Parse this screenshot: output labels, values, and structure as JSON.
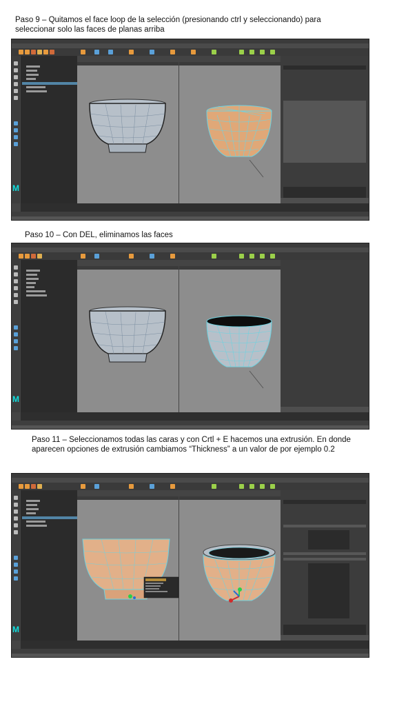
{
  "steps": [
    {
      "caption": "Paso 9 – Quitamos el face loop de la selección (presionando ctrl y seleccionando) para seleccionar solo las faces de planas arriba"
    },
    {
      "caption": "Paso 10 – Con DEL, eliminamos las faces"
    },
    {
      "caption": "Paso 11 – Seleccionamos todas las caras y con Crtl + E hacemos una extrusión. En donde aparecen opciones de extrusión cambiamos “Thickness” a un valor de por ejemplo 0.2"
    }
  ],
  "colors": {
    "maya_dark": "#444444",
    "viewport": "#8d8d8d",
    "face_selected": "#e0a878",
    "wire": "#6fd2e0"
  },
  "icons": [
    "maya-logo-icon"
  ]
}
